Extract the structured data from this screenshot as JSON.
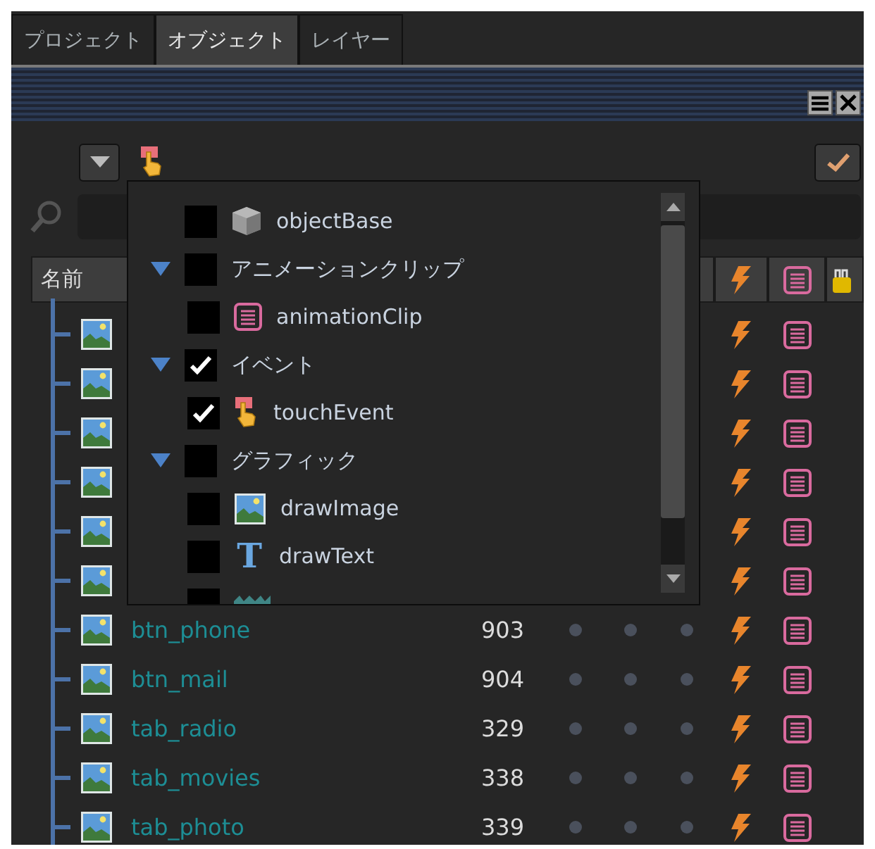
{
  "tabs": [
    {
      "label": "プロジェクト",
      "selected": false
    },
    {
      "label": "オブジェクト",
      "selected": true
    },
    {
      "label": "レイヤー",
      "selected": false
    }
  ],
  "table": {
    "header": {
      "name": "名前"
    },
    "rows": [
      {
        "kind": "image"
      },
      {
        "kind": "image"
      },
      {
        "kind": "image"
      },
      {
        "kind": "image"
      },
      {
        "kind": "image"
      },
      {
        "kind": "image"
      },
      {
        "kind": "image",
        "name": "btn_phone",
        "number": "903"
      },
      {
        "kind": "image",
        "name": "btn_mail",
        "number": "904"
      },
      {
        "kind": "image",
        "name": "tab_radio",
        "number": "329"
      },
      {
        "kind": "image",
        "name": "tab_movies",
        "number": "338"
      },
      {
        "kind": "image",
        "name": "tab_photo",
        "number": "339"
      }
    ]
  },
  "filter_popup": {
    "items": [
      {
        "label": "objectBase",
        "kind": "cube",
        "checked": false
      },
      {
        "label": "アニメーションクリップ",
        "kind": "group",
        "expanded": true,
        "checked": false,
        "children": [
          {
            "label": "animationClip",
            "kind": "notes",
            "checked": false
          }
        ]
      },
      {
        "label": "イベント",
        "kind": "group",
        "expanded": true,
        "checked": true,
        "children": [
          {
            "label": "touchEvent",
            "kind": "touch",
            "checked": true
          }
        ]
      },
      {
        "label": "グラフィック",
        "kind": "group",
        "expanded": true,
        "checked": false,
        "children": [
          {
            "label": "drawImage",
            "kind": "image",
            "checked": false
          },
          {
            "label": "drawText",
            "kind": "text",
            "glyph": "T",
            "checked": false
          },
          {
            "kind": "fill",
            "checked": false
          }
        ]
      }
    ]
  }
}
